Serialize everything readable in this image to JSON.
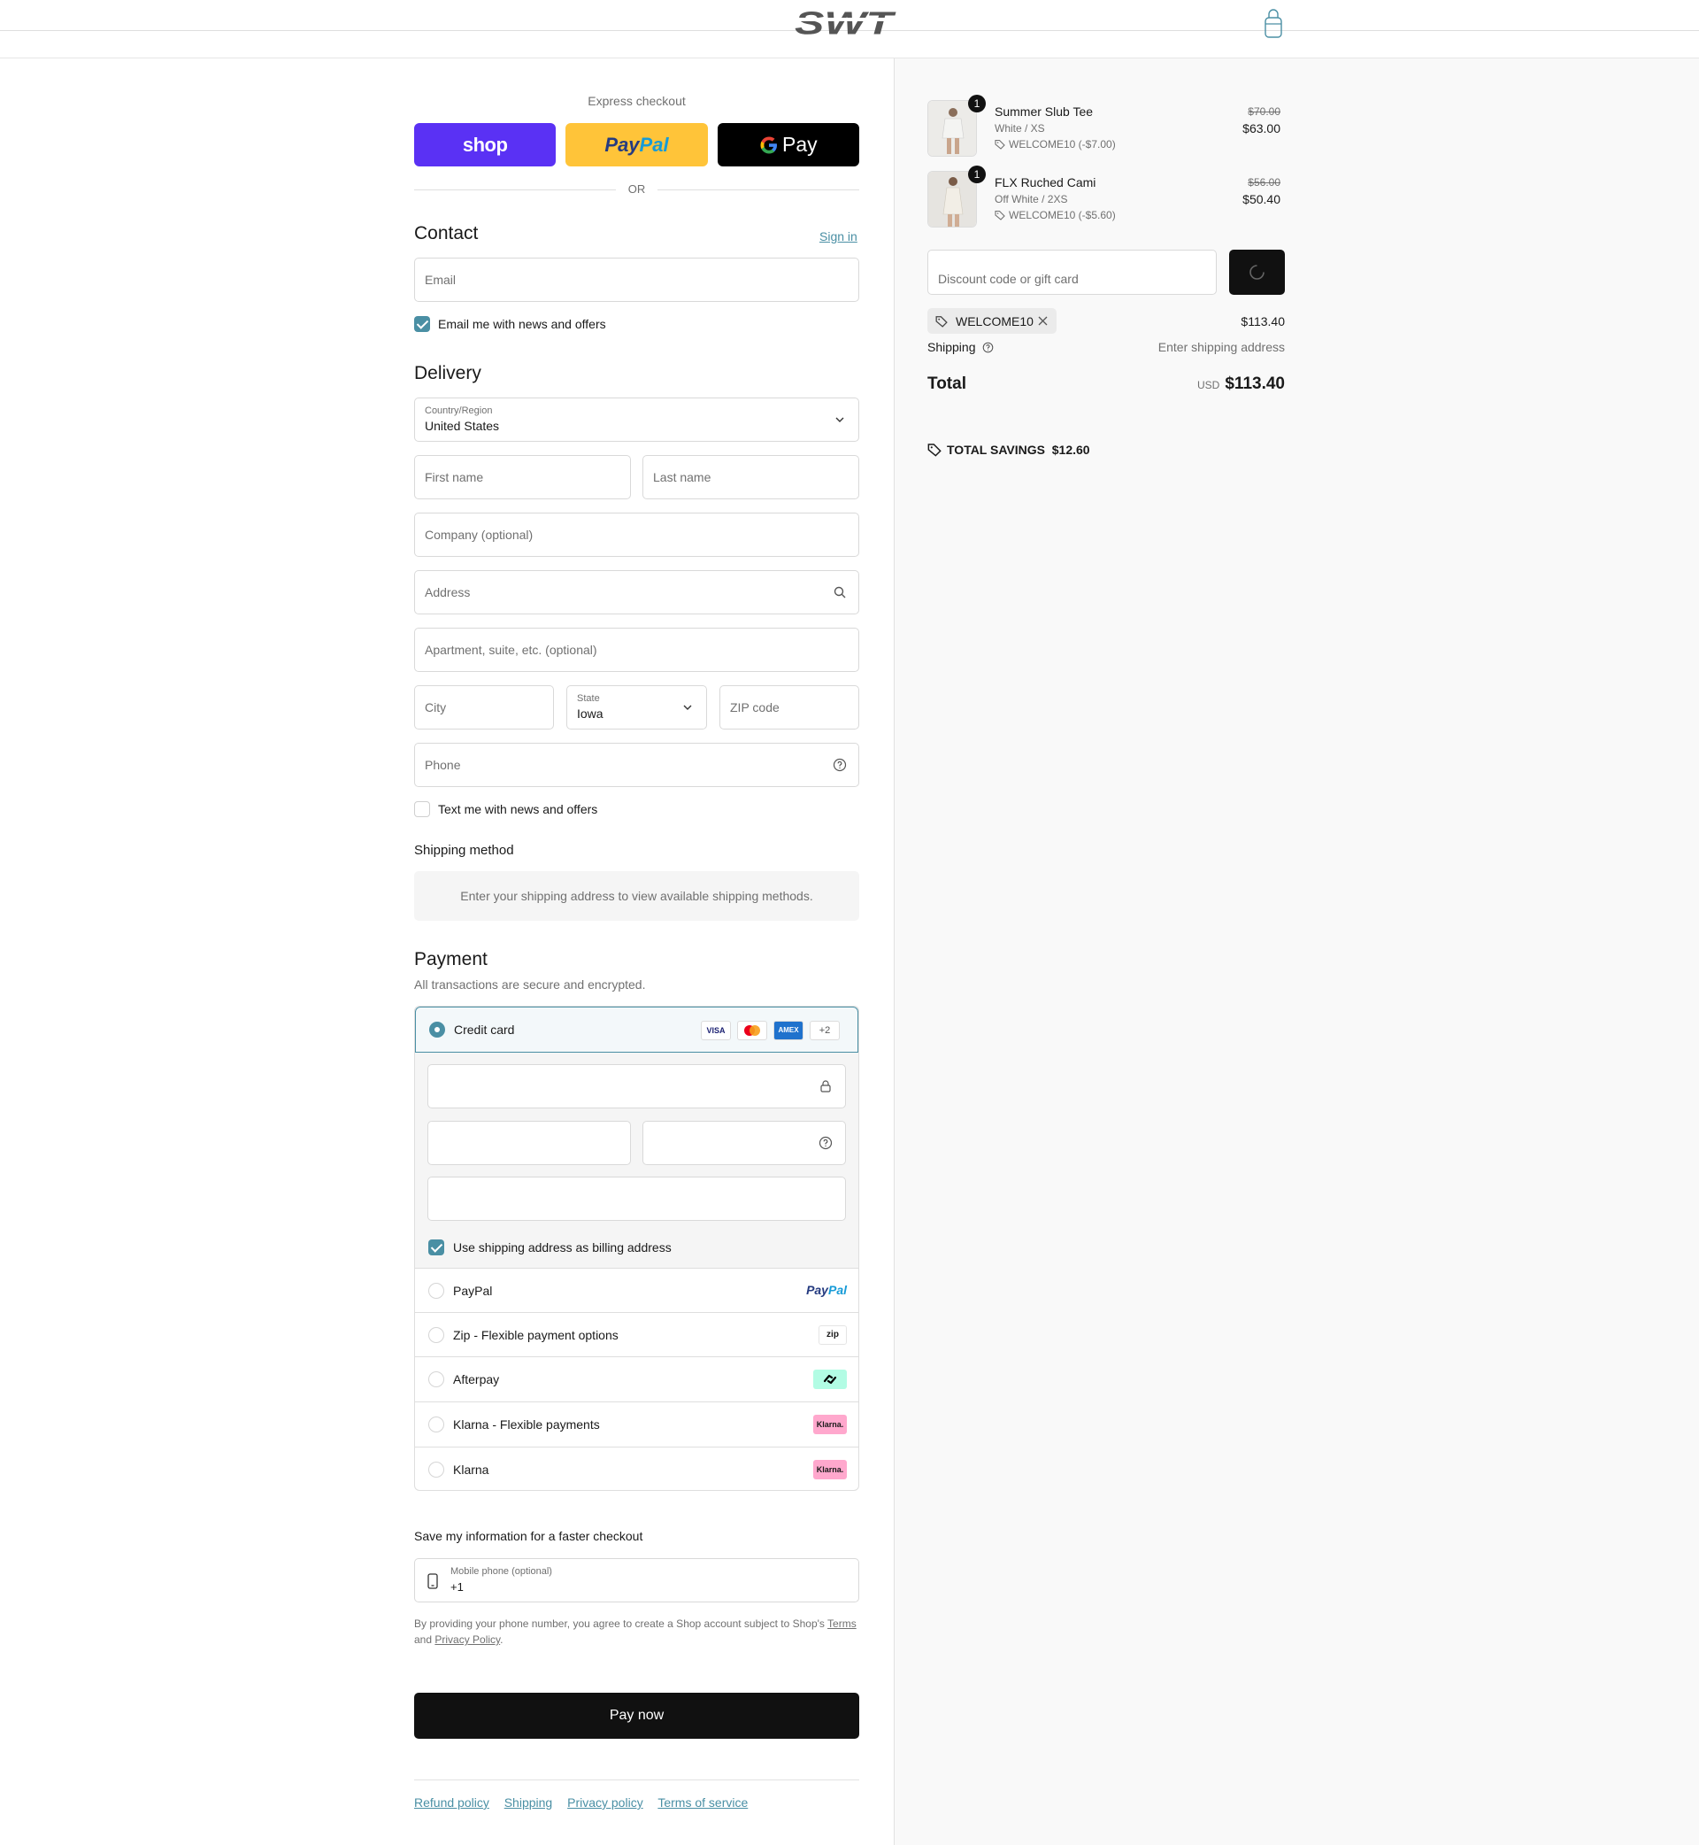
{
  "header": {
    "logo_text": "SWT",
    "icons": {
      "bag": "shopping-bag-icon"
    }
  },
  "express": {
    "title": "Express checkout",
    "shop_label": "shop",
    "paypal_label": "PayPal",
    "gpay_label": "G Pay",
    "or_label": "OR"
  },
  "contact": {
    "title": "Contact",
    "sign_in": "Sign in",
    "email_placeholder": "Email",
    "newsletter_label": "Email me with news and offers",
    "newsletter_checked": true
  },
  "delivery": {
    "title": "Delivery",
    "country_label": "Country/Region",
    "country_value": "United States",
    "first_name": "First name",
    "last_name": "Last name",
    "company": "Company (optional)",
    "address": "Address",
    "apartment": "Apartment, suite, etc. (optional)",
    "city": "City",
    "state_label": "State",
    "state_value": "Iowa",
    "zip": "ZIP code",
    "phone": "Phone",
    "sms_label": "Text me with news and offers",
    "sms_checked": false
  },
  "shipping_method": {
    "title": "Shipping method",
    "info": "Enter your shipping address to view available shipping methods."
  },
  "payment": {
    "title": "Payment",
    "subtitle": "All transactions are secure and encrypted.",
    "credit_card_label": "Credit card",
    "card_badges": [
      "VISA",
      "",
      "AMEX",
      "+2"
    ],
    "billing_same_label": "Use shipping address as billing address",
    "billing_same_checked": true,
    "options": [
      {
        "label": "PayPal",
        "logo": "PayPal"
      },
      {
        "label": "Zip - Flexible payment options",
        "logo": "zip"
      },
      {
        "label": "Afterpay",
        "logo": "afterpay"
      },
      {
        "label": "Klarna - Flexible payments",
        "logo": "Klarna."
      },
      {
        "label": "Klarna",
        "logo": "Klarna."
      }
    ]
  },
  "save_info": {
    "title": "Save my information for a faster checkout",
    "phone_label": "Mobile phone (optional)",
    "phone_value": "+1",
    "legal_text": "By providing your phone number, you agree to create a Shop account subject to Shop's",
    "terms": "Terms",
    "and": "and",
    "privacy": "Privacy Policy",
    "period": "."
  },
  "pay_now": "Pay now",
  "footer_links": [
    "Refund policy",
    "Shipping",
    "Privacy policy",
    "Terms of service"
  ],
  "summary": {
    "items": [
      {
        "qty": "1",
        "name": "Summer Slub Tee",
        "variant": "White / XS",
        "discount": "WELCOME10 (-$7.00)",
        "old_price": "$70.00",
        "price": "$63.00"
      },
      {
        "qty": "1",
        "name": "FLX Ruched Cami",
        "variant": "Off White / 2XS",
        "discount": "WELCOME10 (-$5.60)",
        "old_price": "$56.00",
        "price": "$50.40"
      }
    ],
    "discount_placeholder": "Discount code or gift card",
    "applied_code": "WELCOME10",
    "subtotal": "$113.40",
    "shipping_label": "Shipping",
    "shipping_value": "Enter shipping address",
    "total_label": "Total",
    "currency": "USD",
    "total_value": "$113.40",
    "savings_label": "TOTAL SAVINGS",
    "savings_value": "$12.60"
  },
  "colors": {
    "accent": "#4a8fa4",
    "shop": "#5a31f4",
    "paypal": "#ffc439",
    "dark": "#111111"
  }
}
